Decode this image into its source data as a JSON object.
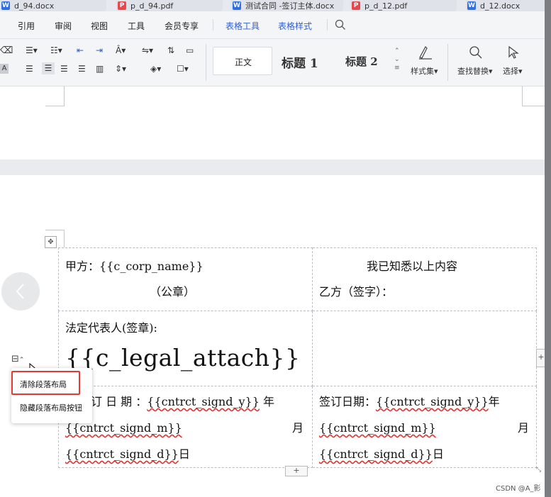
{
  "tabs": [
    {
      "label": "d_94.docx",
      "type": "W"
    },
    {
      "label": "p_d_94.pdf",
      "type": "P"
    },
    {
      "label": "测试合同 -签订主体.docx",
      "type": "W"
    },
    {
      "label": "p_d_12.pdf",
      "type": "P"
    },
    {
      "label": "d_12.docx",
      "type": "W"
    }
  ],
  "menu": [
    "引用",
    "审阅",
    "视图",
    "工具",
    "会员专享",
    "表格工具",
    "表格样式"
  ],
  "ribbon": {
    "styles": {
      "normal": "正文",
      "heading1": "标题 1",
      "heading2": "标题 2"
    },
    "style_set": "样式集",
    "find_replace": "查找替换",
    "select": "选择",
    "a_label": "A"
  },
  "table": {
    "party_a": "甲方：{{c_corp_name}}",
    "seal": "（公章）",
    "known": "我已知悉以上内容",
    "party_b": "乙方（签字）：",
    "legal_rep": "法定代表人(签章):",
    "legal_attach": "{{c_legal_attach}}",
    "date_left_label": "订 日 期 ：",
    "date_right_label": "签订日期：",
    "sign_y": "{{cntrct_signd_y}}",
    "sign_m": "{{cntrct_signd_m}}",
    "sign_d": "{{cntrct_signd_d}}",
    "year": "年",
    "month": "月",
    "day": "日",
    "year_left": " 年"
  },
  "popup": {
    "clear_layout": "清除段落布局",
    "hide_button": "隐藏段落布局按钮"
  },
  "add_row": "+",
  "watermark": "CSDN @A_影"
}
